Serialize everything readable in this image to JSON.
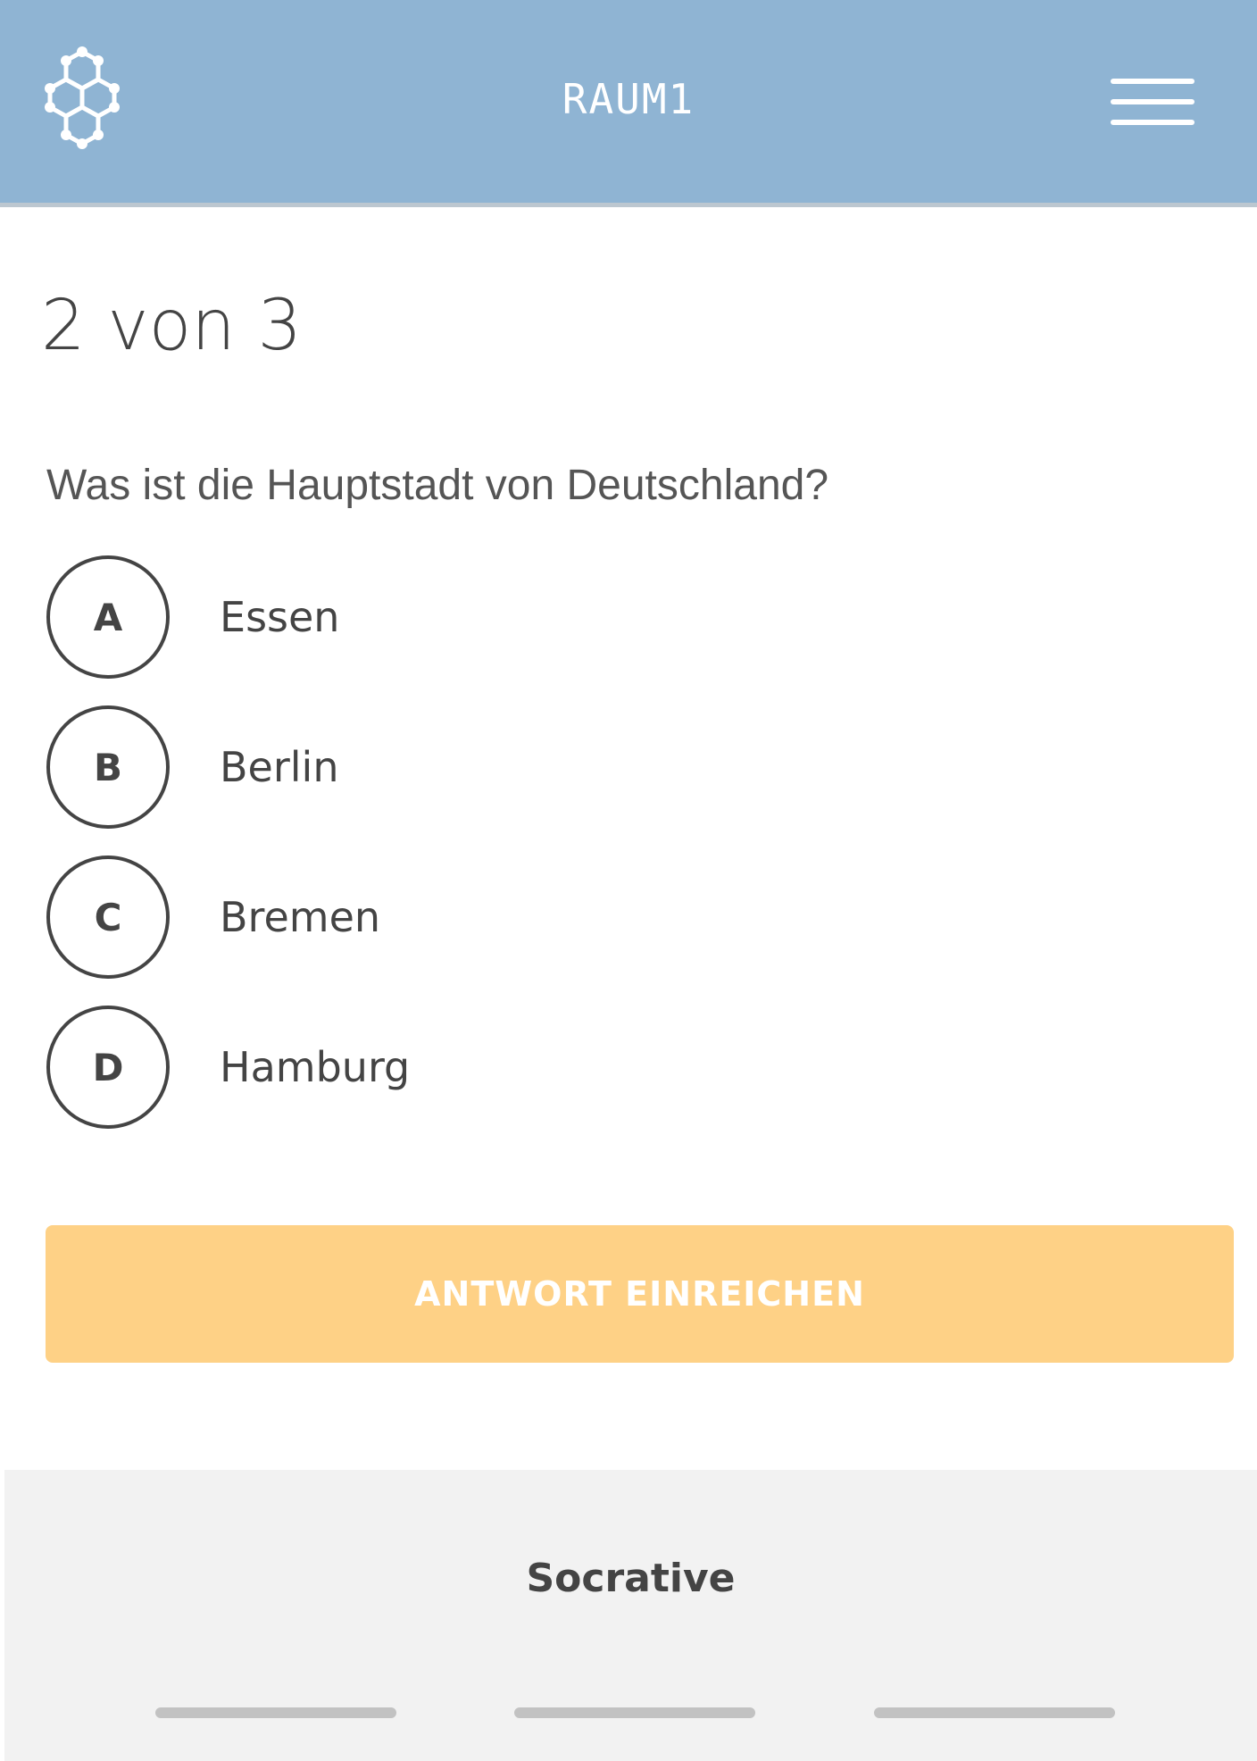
{
  "header": {
    "room_title": "RAUM1",
    "logo_icon": "hexagon-molecule-logo-icon",
    "menu_icon": "hamburger-menu-icon",
    "background_color": "#8fb4d3"
  },
  "quiz": {
    "progress": "2 von 3",
    "question": "Was ist die Hauptstadt von Deutschland?",
    "answers": [
      {
        "letter": "A",
        "text": "Essen"
      },
      {
        "letter": "B",
        "text": "Berlin"
      },
      {
        "letter": "C",
        "text": "Bremen"
      },
      {
        "letter": "D",
        "text": "Hamburg"
      }
    ],
    "submit_label": "ANTWORT EINREICHEN",
    "submit_color": "#fed186"
  },
  "footer": {
    "brand": "Socrative"
  }
}
